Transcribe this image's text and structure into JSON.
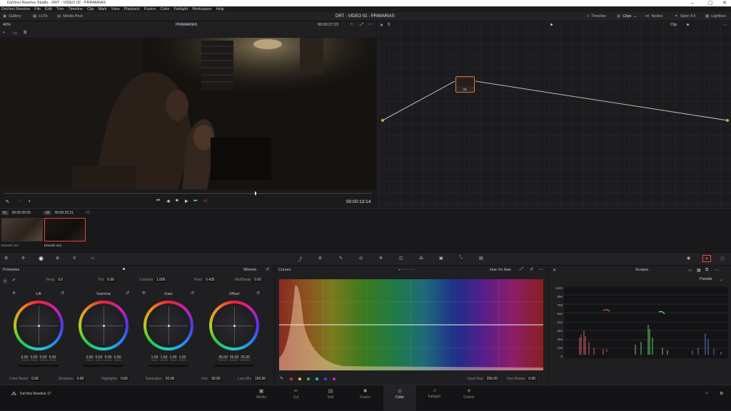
{
  "window": {
    "title": "DaVinci Resolve Studio - DRT - VIDEO 02 - PRIMARIAS"
  },
  "menu": [
    "DaVinci Resolve",
    "File",
    "Edit",
    "Trim",
    "Timeline",
    "Clip",
    "Mark",
    "View",
    "Playback",
    "Fusion",
    "Color",
    "Fairlight",
    "Workspace",
    "Help"
  ],
  "toolbar": {
    "gallery": "Gallery",
    "luts": "LUTs",
    "media_pool": "Media Pool",
    "project_title": "DRT - VIDEO 02 - PRIMARIAS",
    "timeline": "Timeline",
    "clips": "Clips",
    "nodes": "Nodes",
    "openfx": "Open FX",
    "lightbox": "Lightbox"
  },
  "viewer": {
    "zoom": "49%",
    "clip_name": "PRIMARIAS",
    "timecode_top": "00:00:27:23",
    "timecode": "00:00:13:14"
  },
  "nodes": {
    "mode": "Clip",
    "node_label": "01"
  },
  "clips": [
    {
      "num": "01",
      "tc": "00:00:05:05",
      "track": "V1",
      "codec": "DNxHR 444"
    },
    {
      "num": "02",
      "tc": "00:00:26:21",
      "track": "V1",
      "codec": "DNxHR 444"
    }
  ],
  "primaries": {
    "title": "Primaries",
    "mode": "Wheels",
    "temp_label": "Temp",
    "temp": "0.0",
    "tint_label": "Tint",
    "tint": "0.00",
    "contrast_label": "Contrast",
    "contrast": "1.000",
    "pivot_label": "Pivot",
    "pivot": "0.435",
    "middetail_label": "Mid/Detail",
    "middetail": "0.00",
    "wheels": [
      {
        "name": "Lift",
        "vals": [
          "0.00",
          "0.00",
          "0.00",
          "0.00"
        ]
      },
      {
        "name": "Gamma",
        "vals": [
          "0.00",
          "0.00",
          "0.00",
          "0.00"
        ]
      },
      {
        "name": "Gain",
        "vals": [
          "1.00",
          "1.00",
          "1.00",
          "1.00"
        ]
      },
      {
        "name": "Offset",
        "vals": [
          "25.00",
          "25.00",
          "25.00"
        ]
      }
    ],
    "colorboost_label": "Color Boost",
    "colorboost": "0.00",
    "shadows_label": "Shadows",
    "shadows": "0.00",
    "highlights_label": "Highlights",
    "highlights": "0.00",
    "saturation_label": "Saturation",
    "saturation": "50.00",
    "hue_label": "Hue",
    "hue": "50.00",
    "lummix_label": "Lum Mix",
    "lummix": "100.00"
  },
  "curves": {
    "title": "Curves",
    "mode": "Hue Vs Hue",
    "input_hue_label": "Input Hue",
    "input_hue": "256.00",
    "hue_rotate_label": "Hue Rotate",
    "hue_rotate": "0.00"
  },
  "scopes": {
    "title": "Scopes",
    "mode": "Parade",
    "ticks": [
      "1023",
      "896",
      "768",
      "640",
      "512",
      "384",
      "256",
      "128",
      "0"
    ]
  },
  "app": {
    "name": "DaVinci Resolve 17"
  },
  "pages": [
    "Media",
    "Cut",
    "Edit",
    "Fusion",
    "Color",
    "Fairlight",
    "Deliver"
  ],
  "active_page": "Color"
}
